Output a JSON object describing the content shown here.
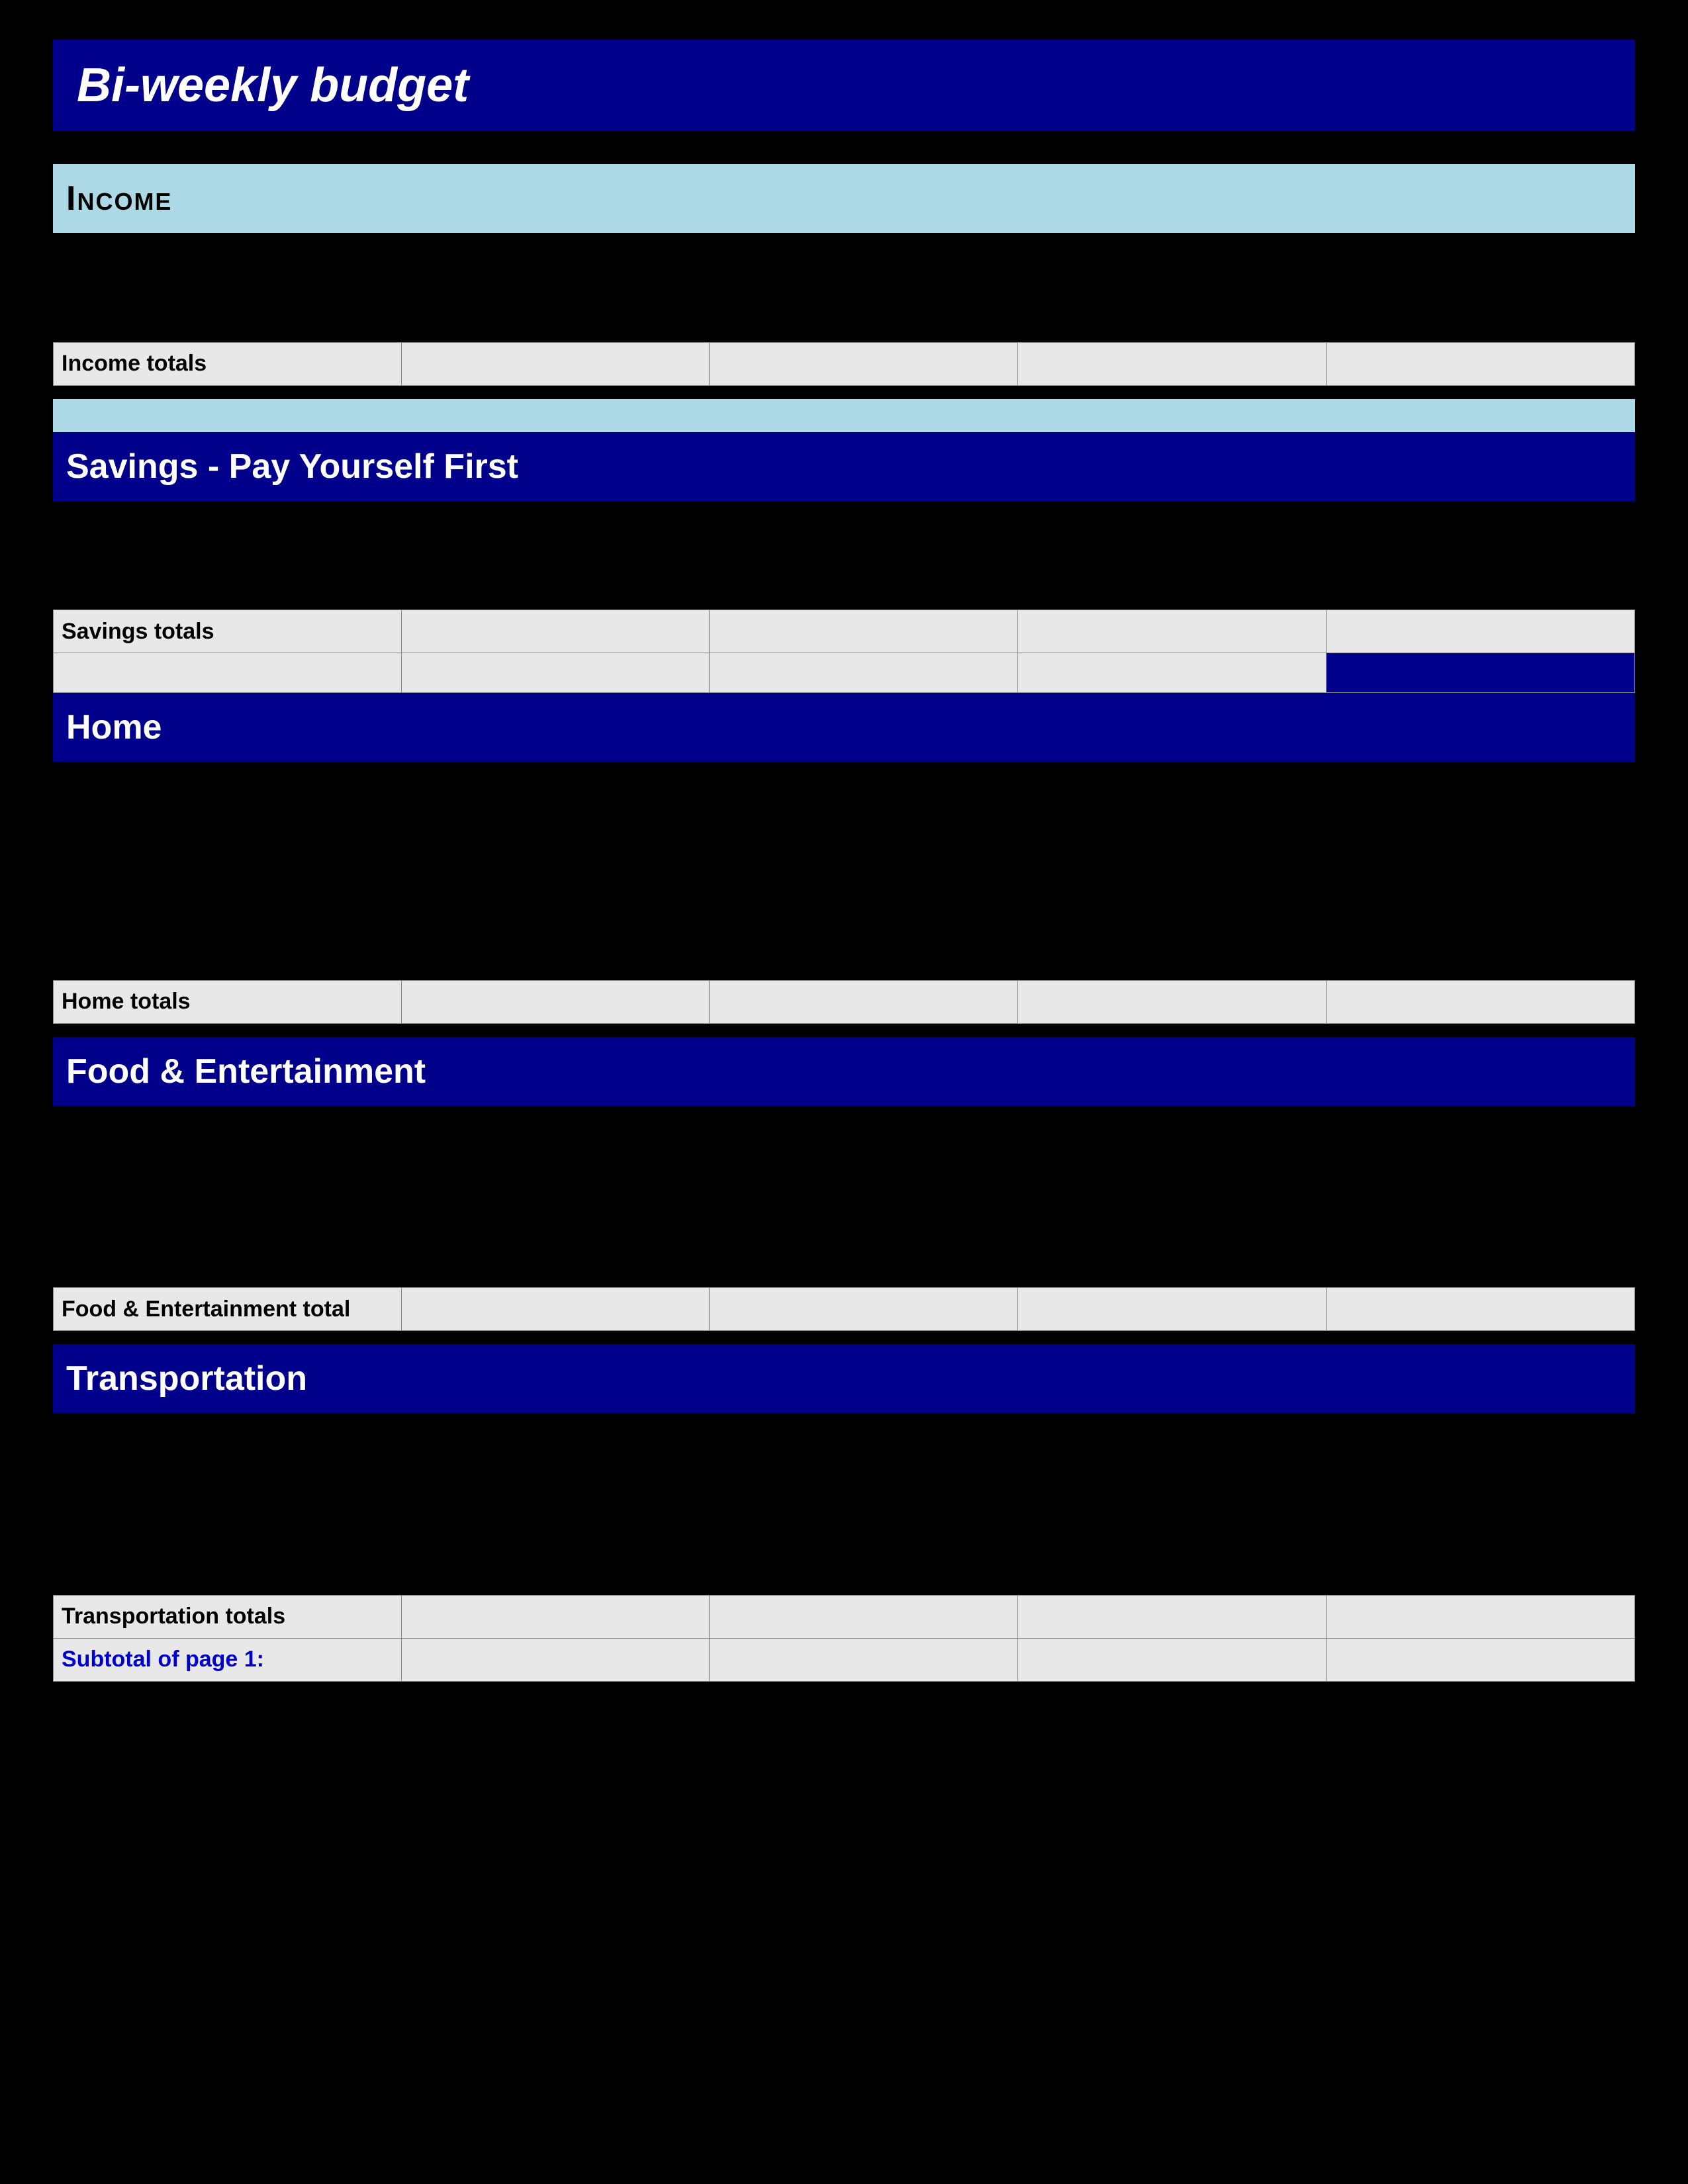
{
  "page": {
    "title": "Bi-weekly  budget"
  },
  "sections": {
    "income": {
      "label": "Income",
      "total_label": "Income totals"
    },
    "savings": {
      "label": "Savings - Pay Yourself First",
      "total_label": "Savings totals"
    },
    "home": {
      "label": "Home",
      "total_label": "Home totals"
    },
    "food": {
      "label": "Food & Entertainment",
      "total_label": "Food & Entertainment total"
    },
    "transportation": {
      "label": "Transportation",
      "total_label": "Transportation totals"
    },
    "subtotal": {
      "label": "Subtotal of page 1:"
    }
  }
}
